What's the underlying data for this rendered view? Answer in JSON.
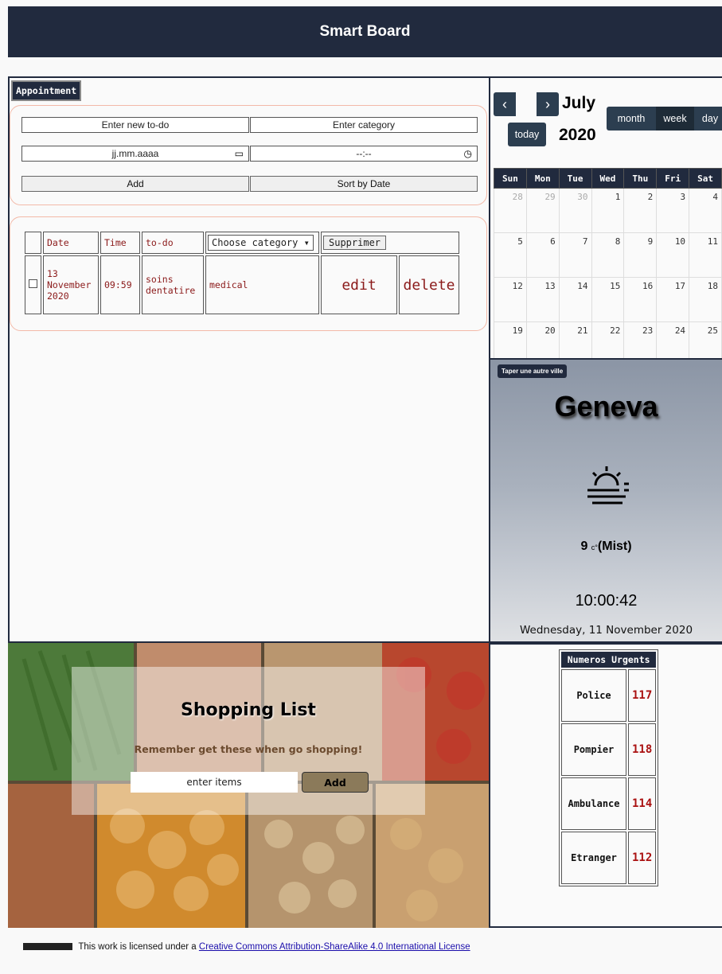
{
  "header": {
    "title": "Smart Board"
  },
  "appointment": {
    "tag": "Appointment",
    "todo_placeholder": "Enter new to-do",
    "category_placeholder": "Enter category",
    "date_placeholder": "jj.mm.aaaa",
    "time_placeholder": "--:--",
    "add_label": "Add",
    "sort_label": "Sort by Date",
    "table": {
      "headers": {
        "date": "Date",
        "time": "Time",
        "todo": "to-do",
        "category_select": "Choose category",
        "delete_all": "Supprimer"
      },
      "rows": [
        {
          "date": "13 November 2020",
          "time": "09:59",
          "todo": "soins dentatire",
          "category": "medical",
          "edit": "edit",
          "delete": "delete"
        }
      ]
    }
  },
  "calendar": {
    "prev": "‹",
    "next": "›",
    "today": "today",
    "month": "July",
    "year": "2020",
    "views": [
      "month",
      "week",
      "day"
    ],
    "weekdays": [
      "Sun",
      "Mon",
      "Tue",
      "Wed",
      "Thu",
      "Fri",
      "Sat"
    ],
    "weeks": [
      [
        "28",
        "29",
        "30",
        "1",
        "2",
        "3",
        "4"
      ],
      [
        "5",
        "6",
        "7",
        "8",
        "9",
        "10",
        "11"
      ],
      [
        "12",
        "13",
        "14",
        "15",
        "16",
        "17",
        "18"
      ],
      [
        "19",
        "20",
        "21",
        "22",
        "23",
        "24",
        "25"
      ]
    ]
  },
  "weather": {
    "city_button": "Taper une autre ville",
    "city": "Geneva",
    "icon": "fog-sun-icon",
    "temp": "9",
    "unit": "c°",
    "condition": "(Mist)",
    "time": "10:00:42",
    "date": "Wednesday, 11 November 2020"
  },
  "shopping": {
    "title": "Shopping List",
    "subtitle": "Remember get these when go shopping!",
    "input_placeholder": "enter items",
    "add_label": "Add"
  },
  "urgent": {
    "title": "Numeros Urgents",
    "rows": [
      {
        "name": "Police",
        "number": "117"
      },
      {
        "name": "Pompier",
        "number": "118"
      },
      {
        "name": "Ambulance",
        "number": "114"
      },
      {
        "name": "Etranger",
        "number": "112"
      }
    ]
  },
  "footer": {
    "badge": "cc by-sa",
    "text": "This work is licensed under a",
    "link": "Creative Commons Attribution-ShareAlike 4.0 International License"
  }
}
